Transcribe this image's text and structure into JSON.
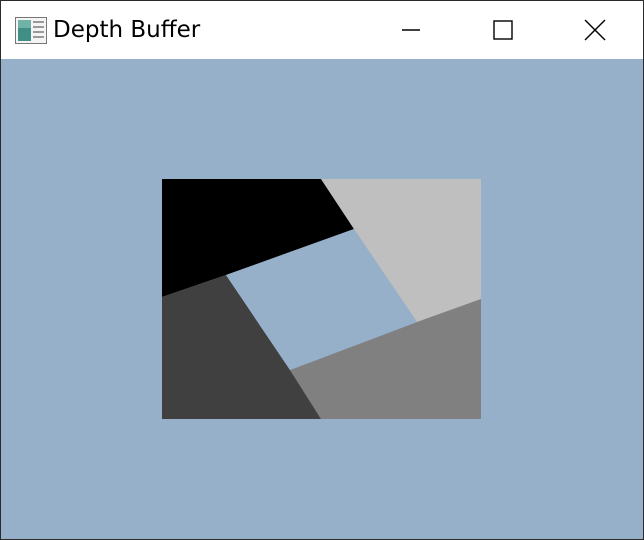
{
  "window": {
    "title": "Depth Buffer",
    "icon": "app-window-icon",
    "controls": [
      "minimize-icon",
      "maximize-icon",
      "close-icon"
    ]
  },
  "scene": {
    "background_color": "#97b0c9",
    "quads": [
      {
        "name": "quad-black",
        "color": "#000000"
      },
      {
        "name": "quad-light-gray",
        "color": "#bfbfbf"
      },
      {
        "name": "quad-mid-gray",
        "color": "#808080"
      },
      {
        "name": "quad-dark-gray",
        "color": "#404040"
      },
      {
        "name": "center-hole",
        "color": "#97b0c9"
      }
    ]
  }
}
